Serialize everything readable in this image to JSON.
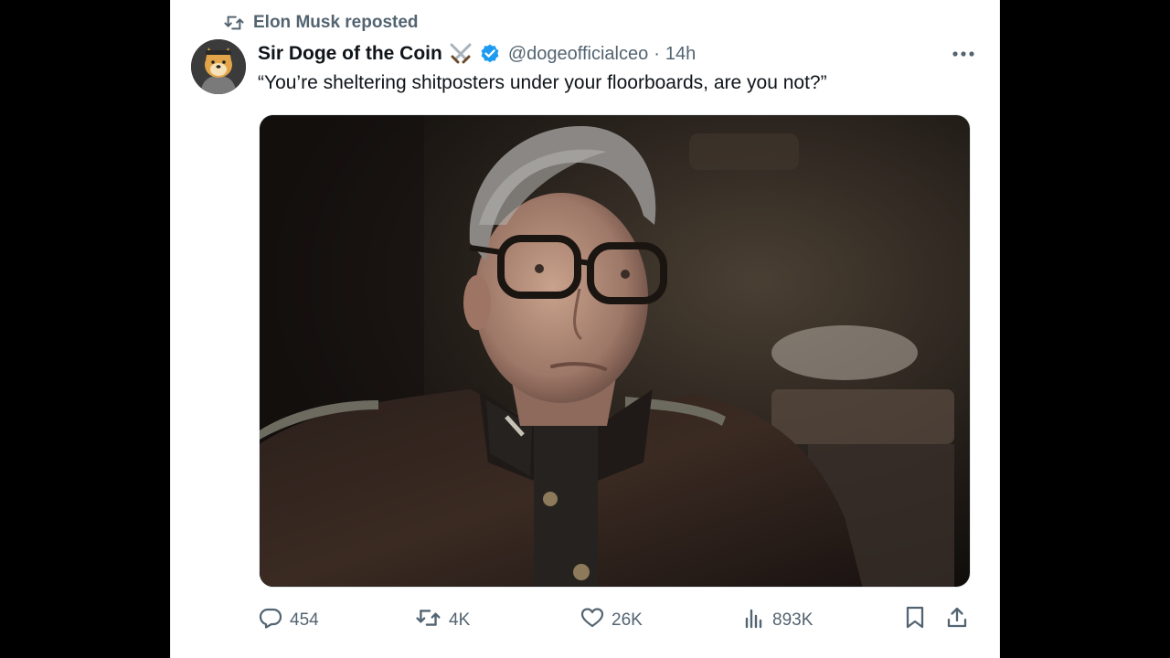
{
  "repost": {
    "text": "Elon Musk reposted",
    "icon": "repost-icon"
  },
  "author": {
    "name": "Sir Doge of the Coin",
    "name_emoji": "crossed-swords-icon",
    "verified": true,
    "handle": "@dogeofficialceo",
    "separator": "·",
    "time": "14h"
  },
  "tweet": {
    "text": "“You’re sheltering shitposters under your floorboards, are you not?”"
  },
  "actions": {
    "replies": "454",
    "reposts": "4K",
    "likes": "26K",
    "views": "893K"
  },
  "colors": {
    "muted": "#536471",
    "text": "#0f1419",
    "verified": "#1d9bf0"
  }
}
